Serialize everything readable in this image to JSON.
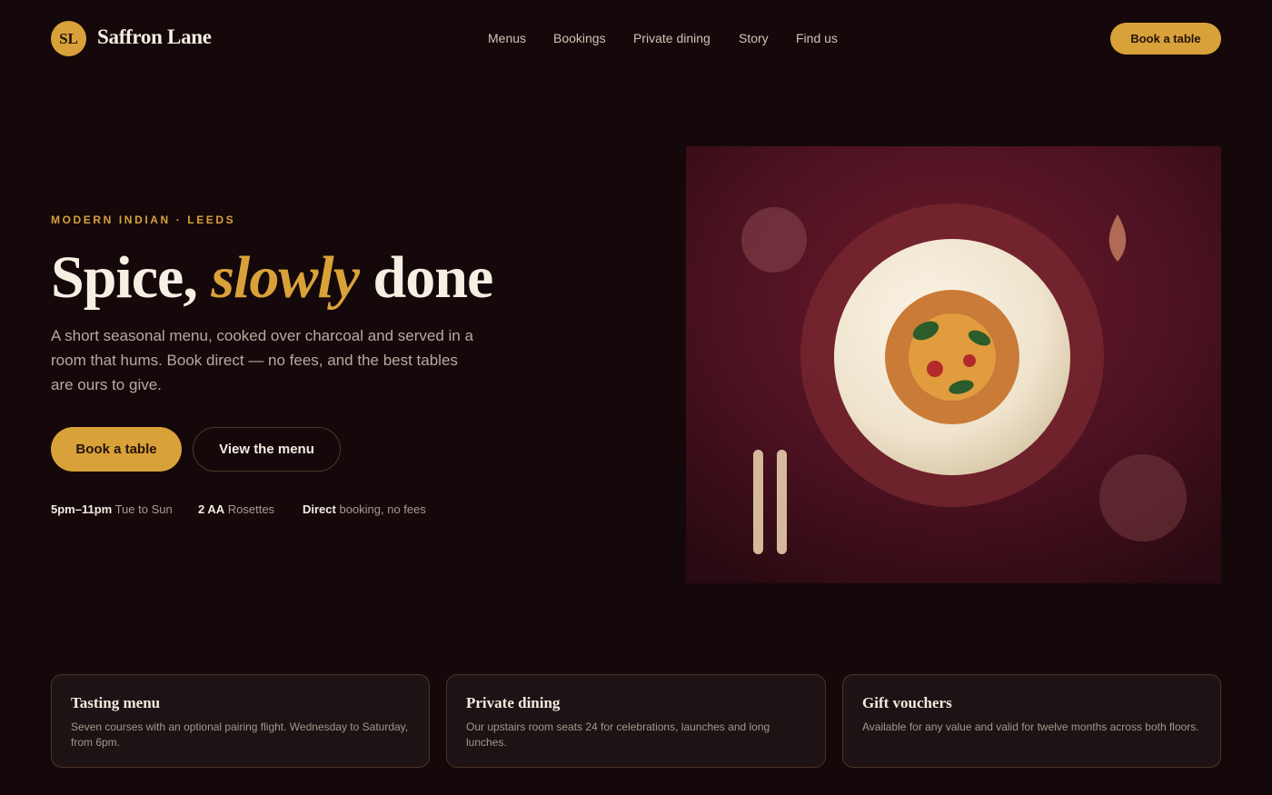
{
  "header": {
    "logo_initials": "SL",
    "brand": "Saffron Lane",
    "nav": [
      "Menus",
      "Bookings",
      "Private dining",
      "Story",
      "Find us"
    ],
    "cta_label": "Book a table"
  },
  "hero": {
    "eyebrow": "MODERN INDIAN · LEEDS",
    "headline_before": "Spice, ",
    "headline_accent": "slowly",
    "headline_after": " done",
    "lede": "A short seasonal menu, cooked over charcoal and served in a room that hums. Book direct — no fees, and the best tables are ours to give.",
    "primary_button": "Book a table",
    "secondary_button": "View the menu",
    "facts": [
      {
        "strong": "5pm–11pm",
        "text": " Tue to Sun"
      },
      {
        "strong": "2 AA",
        "text": " Rosettes"
      },
      {
        "strong": "Direct",
        "text": " booking, no fees"
      }
    ]
  },
  "cards": [
    {
      "title": "Tasting menu",
      "body": "Seven courses with an optional pairing flight. Wednesday to Saturday, from 6pm."
    },
    {
      "title": "Private dining",
      "body": "Our upstairs room seats 24 for celebrations, launches and long lunches."
    },
    {
      "title": "Gift vouchers",
      "body": "Available for any value and valid for twelve months across both floors."
    }
  ],
  "colors": {
    "background": "#14080a",
    "accent": "#d9a13a",
    "card_border": "#4a3526"
  }
}
